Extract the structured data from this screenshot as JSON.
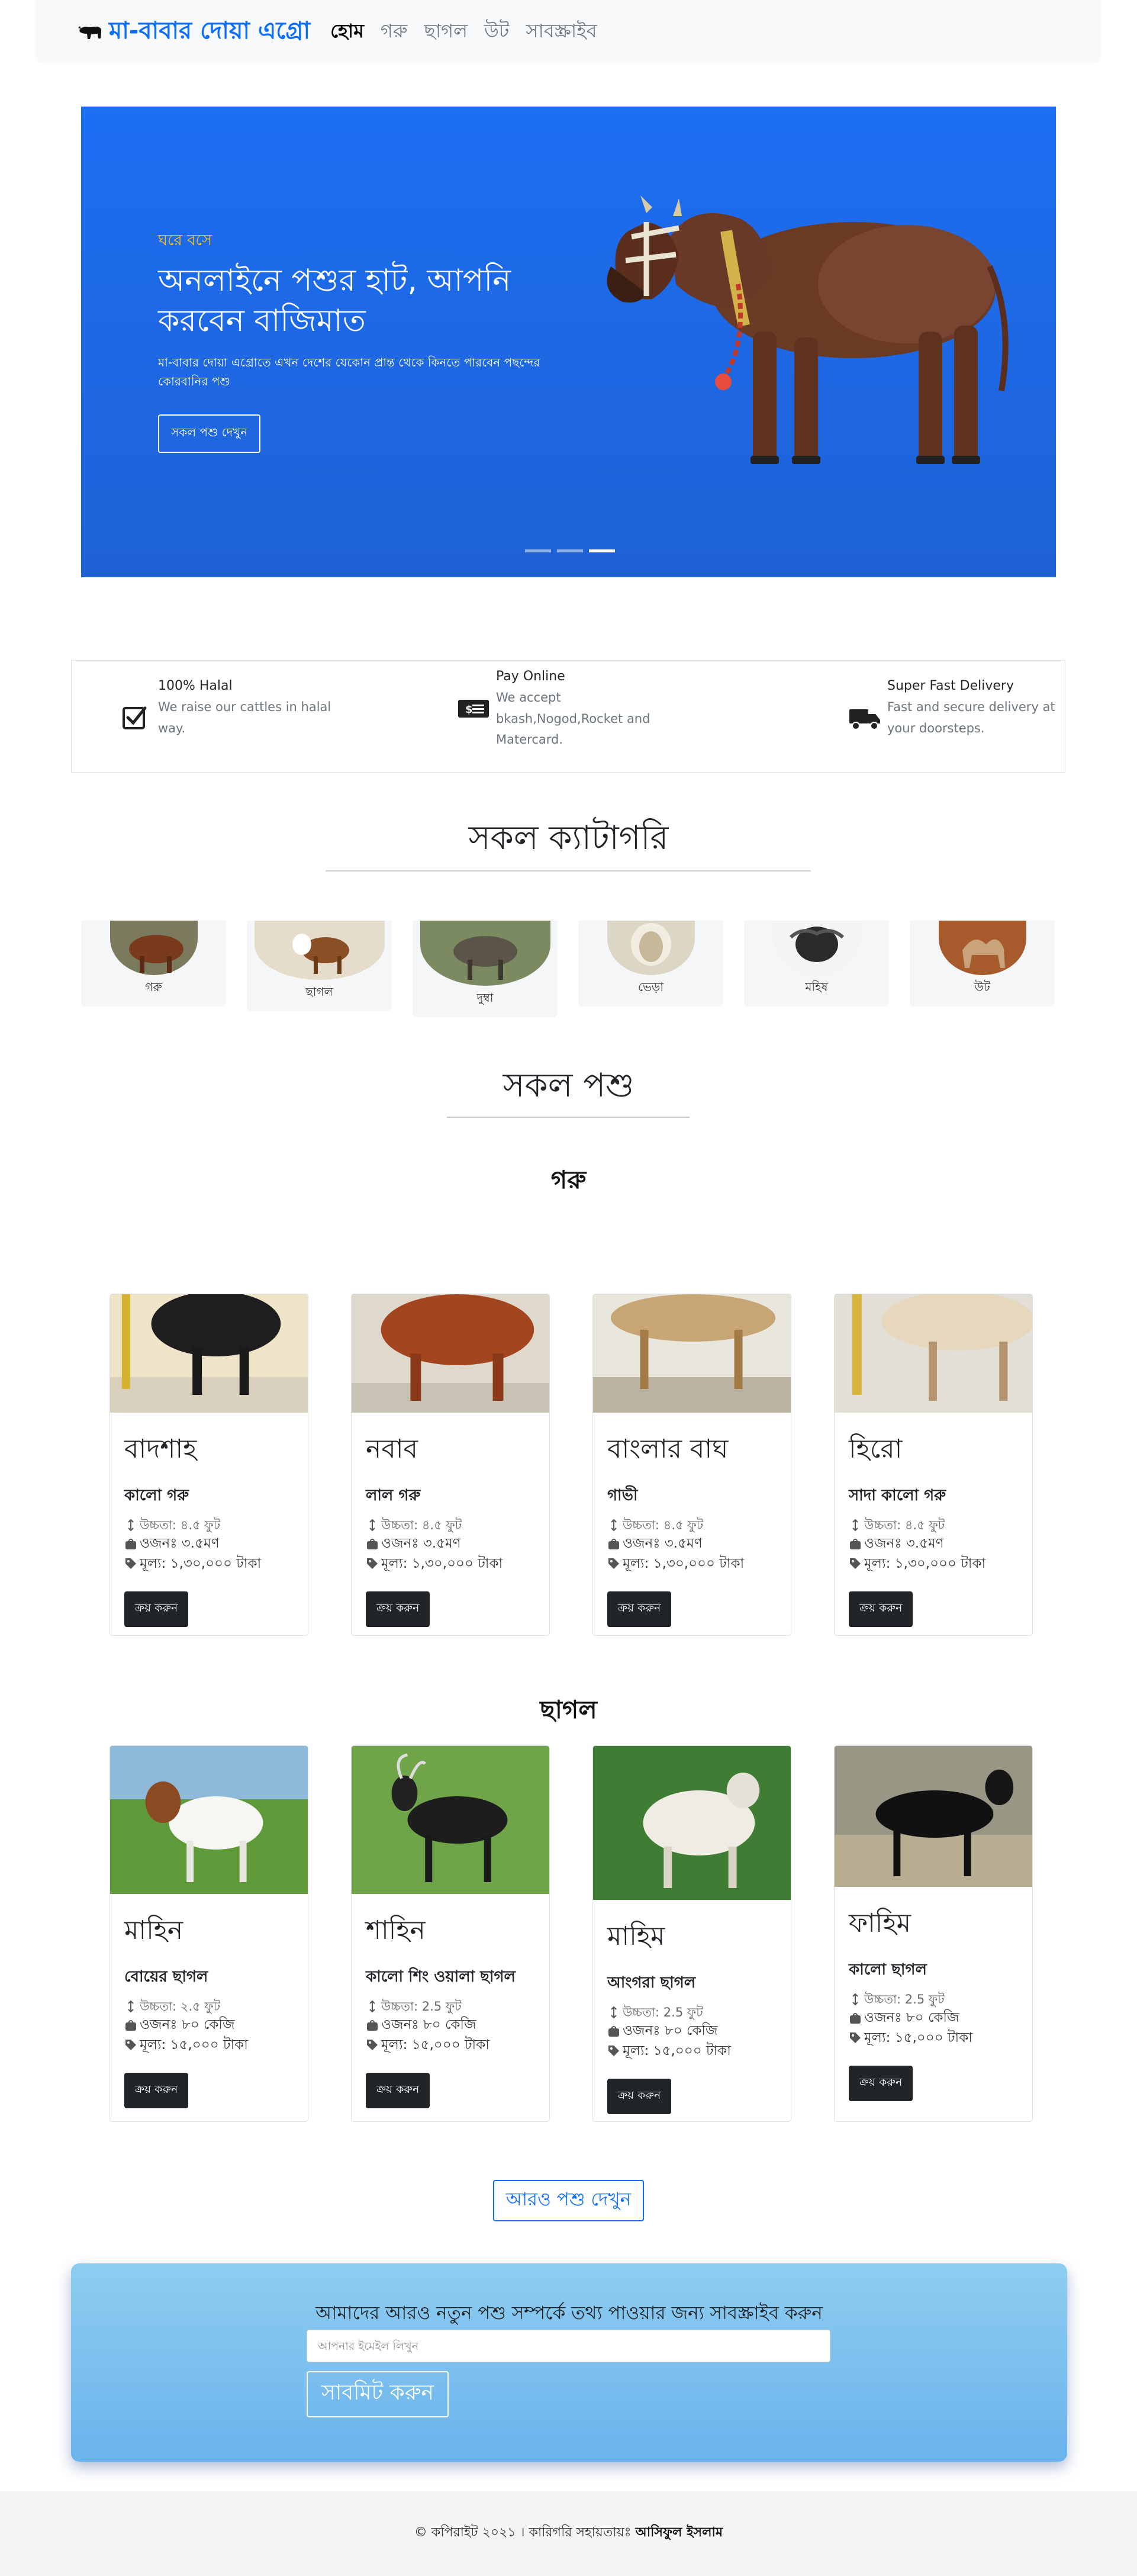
{
  "nav": {
    "brand": "মা-বাবার দোয়া এগ্রো",
    "links": [
      "হোম",
      "গরু",
      "ছাগল",
      "উট",
      "সাবস্ক্রাইব"
    ]
  },
  "hero": {
    "eyebrow": "ঘরে বসে",
    "title": "অনলাইনে পশুর হাট, আপনি করবেন বাজিমাত",
    "description": "মা-বাবার দোয়া এগ্রোতে এখন দেশের যেকোন প্রান্ত থেকে কিনতে পারবেন পছন্দের কোরবানির পশু",
    "button": "সকল পশু দেখুন",
    "active_slide": 3,
    "slide_count": 3
  },
  "features": [
    {
      "icon": "check-square-icon",
      "title": "100% Halal",
      "description": "We raise our cattles in halal way."
    },
    {
      "icon": "money-icon",
      "title": "Pay Online",
      "description": "We accept bkash,Nogod,Rocket and Matercard."
    },
    {
      "icon": "truck-icon",
      "title": "Super Fast Delivery",
      "description": "Fast and secure delivery at your doorsteps."
    }
  ],
  "categories_heading": "সকল ক্যাটাগরি",
  "categories": [
    "গরু",
    "ছাগল",
    "দুম্বা",
    "ভেড়া",
    "মহিষ",
    "উট"
  ],
  "animals_heading": "সকল পশু",
  "cow_heading": "গরু",
  "goat_heading": "ছাগল",
  "cows": [
    {
      "name": "বাদশাহ",
      "breed": "কালো গরু",
      "height": "উচ্চতা: ৪.৫ ফুট",
      "weight": "ওজনঃ ৩.৫মণ",
      "price": "মূল্য: ১,৩০,০০০ টাকা",
      "button": "ক্রয় করুন"
    },
    {
      "name": "নবাব",
      "breed": "লাল গরু",
      "height": "উচ্চতা: ৪.৫ ফুট",
      "weight": "ওজনঃ ৩.৫মণ",
      "price": "মূল্য: ১,৩০,০০০ টাকা",
      "button": "ক্রয় করুন"
    },
    {
      "name": "বাংলার বাঘ",
      "breed": "গাভী",
      "height": "উচ্চতা: ৪.৫ ফুট",
      "weight": "ওজনঃ ৩.৫মণ",
      "price": "মূল্য: ১,৩০,০০০ টাকা",
      "button": "ক্রয় করুন"
    },
    {
      "name": "হিরো",
      "breed": "সাদা কালো গরু",
      "height": "উচ্চতা: ৪.৫ ফুট",
      "weight": "ওজনঃ ৩.৫মণ",
      "price": "মূল্য: ১,৩০,০০০ টাকা",
      "button": "ক্রয় করুন"
    }
  ],
  "goats": [
    {
      "name": "মাহিন",
      "breed": "বোয়ের ছাগল",
      "height": "উচ্চতা: ২.৫ ফুট",
      "weight": "ওজনঃ ৮০ কেজি",
      "price": "মূল্য: ১৫,০০০ টাকা",
      "button": "ক্রয় করুন"
    },
    {
      "name": "শাহিন",
      "breed": "কালো শিং ওয়ালা ছাগল",
      "height": "উচ্চতা: 2.5 ফুট",
      "weight": "ওজনঃ ৮০ কেজি",
      "price": "মূল্য: ১৫,০০০ টাকা",
      "button": "ক্রয় করুন"
    },
    {
      "name": "মাহিম",
      "breed": "আংগরা ছাগল",
      "height": "উচ্চতা: 2.5 ফুট",
      "weight": "ওজনঃ ৮০ কেজি",
      "price": "মূল্য: ১৫,০০০ টাকা",
      "button": "ক্রয় করুন"
    },
    {
      "name": "ফাহিম",
      "breed": "কালো ছাগল",
      "height": "উচ্চতা: 2.5 ফুট",
      "weight": "ওজনঃ ৮০ কেজি",
      "price": "মূল্য: ১৫,০০০ টাকা",
      "button": "ক্রয় করুন"
    }
  ],
  "more_button": "আরও পশু দেখুন",
  "subscribe": {
    "title": "আমাদের আরও নতুন পশু সম্পর্কে তথ্য পাওয়ার জন্য সাবস্ক্রাইব করুন",
    "placeholder": "আপনার ইমেইল লিখুন",
    "button": "সাবমিট করুন"
  },
  "footer": {
    "text": "© কপিরাইট ২০২১ । কারিগরি সহায়তায়ঃ",
    "author": "আসিফুল ইসলাম"
  }
}
